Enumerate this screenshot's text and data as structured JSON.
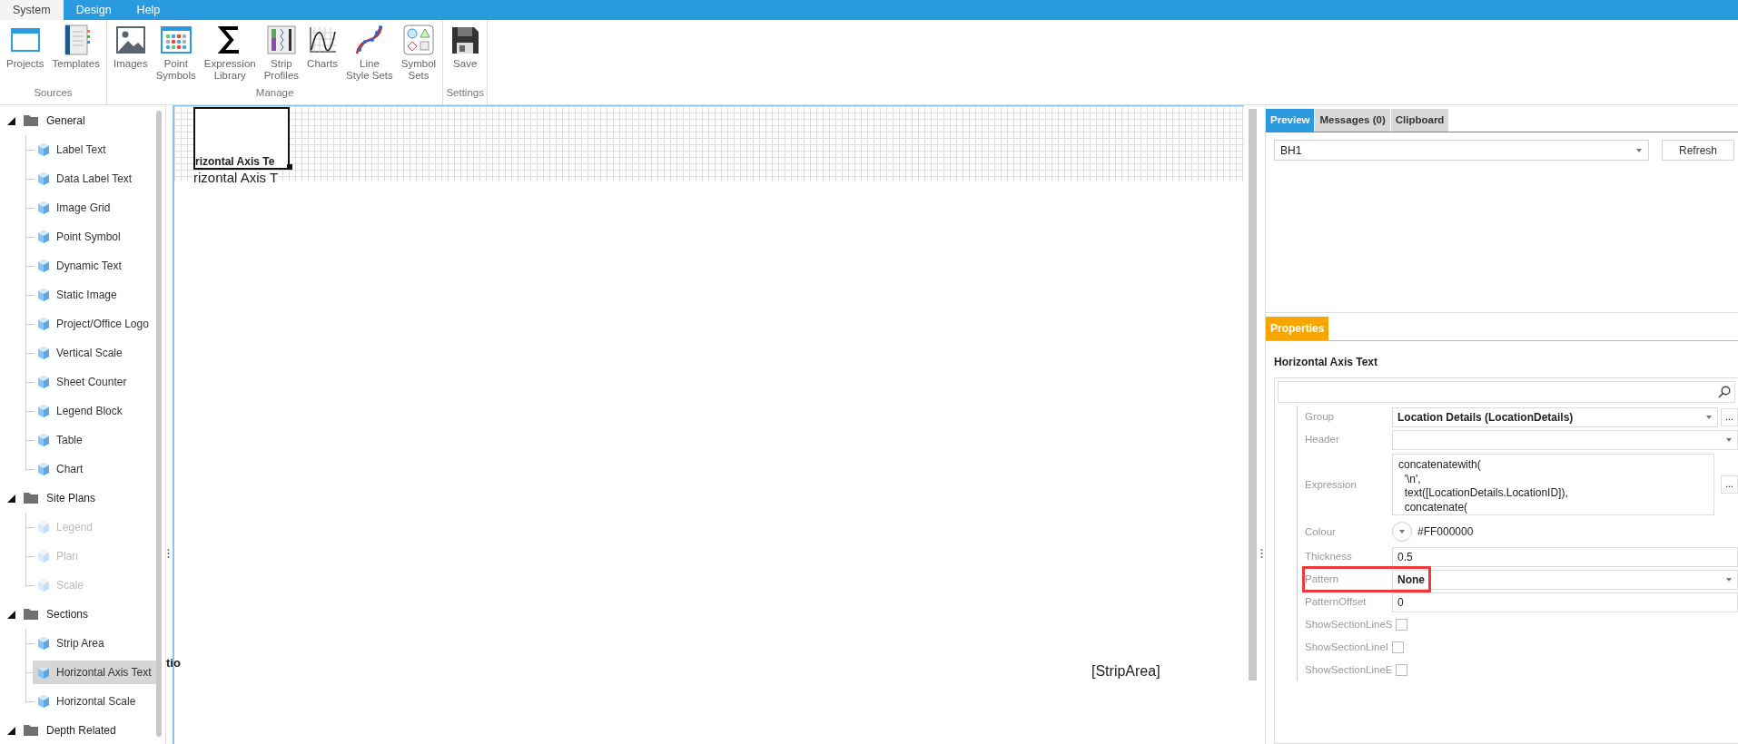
{
  "menu_tabs": [
    {
      "label": "System",
      "selected": true
    },
    {
      "label": "Design",
      "selected": false
    },
    {
      "label": "Help",
      "selected": false
    }
  ],
  "ribbon": {
    "groups": [
      {
        "label": "Sources",
        "buttons": [
          "Projects",
          "Templates"
        ]
      },
      {
        "label": "Manage",
        "buttons": [
          "Images",
          "Point\nSymbols",
          "Expression\nLibrary",
          "Strip\nProfiles",
          "Charts",
          "Line\nStyle Sets",
          "Symbol\nSets"
        ]
      },
      {
        "label": "Settings",
        "buttons": [
          "Save"
        ]
      }
    ]
  },
  "tree": [
    {
      "label": "General",
      "expanded": true,
      "children": [
        {
          "label": "Label Text",
          "disabled": false,
          "selected": false
        },
        {
          "label": "Data Label Text",
          "disabled": false,
          "selected": false
        },
        {
          "label": "Image Grid",
          "disabled": false,
          "selected": false
        },
        {
          "label": "Point Symbol",
          "disabled": false,
          "selected": false
        },
        {
          "label": "Dynamic Text",
          "disabled": false,
          "selected": false
        },
        {
          "label": "Static Image",
          "disabled": false,
          "selected": false
        },
        {
          "label": "Project/Office Logo",
          "disabled": false,
          "selected": false
        },
        {
          "label": "Vertical Scale",
          "disabled": false,
          "selected": false
        },
        {
          "label": "Sheet Counter",
          "disabled": false,
          "selected": false
        },
        {
          "label": "Legend Block",
          "disabled": false,
          "selected": false
        },
        {
          "label": "Table",
          "disabled": false,
          "selected": false
        },
        {
          "label": "Chart",
          "disabled": false,
          "selected": false
        }
      ]
    },
    {
      "label": "Site Plans",
      "expanded": true,
      "children": [
        {
          "label": "Legend",
          "disabled": true,
          "selected": false
        },
        {
          "label": "Plan",
          "disabled": true,
          "selected": false
        },
        {
          "label": "Scale",
          "disabled": true,
          "selected": false
        }
      ]
    },
    {
      "label": "Sections",
      "expanded": true,
      "children": [
        {
          "label": "Strip Area",
          "disabled": false,
          "selected": false
        },
        {
          "label": "Horizontal Axis Text",
          "disabled": false,
          "selected": true
        },
        {
          "label": "Horizontal Scale",
          "disabled": false,
          "selected": false
        }
      ]
    },
    {
      "label": "Depth Related",
      "expanded": true
    }
  ],
  "canvas": {
    "element_caption": "rizontal Axis Te",
    "element_text": "rizontal Axis T",
    "side_label": "tio",
    "strip_area_label": "[StripArea]"
  },
  "preview": {
    "tabs": [
      {
        "label": "Preview",
        "selected": true
      },
      {
        "label": "Messages (0)",
        "selected": false
      },
      {
        "label": "Clipboard",
        "selected": false
      }
    ],
    "borehole": "BH1",
    "refresh_button": "Refresh"
  },
  "properties": {
    "tab": "Properties",
    "title": "Horizontal Axis Text",
    "rows": [
      {
        "label": "Group",
        "kind": "dropdown",
        "value": "Location Details (LocationDetails)",
        "browse_button": "...",
        "highlighted": false
      },
      {
        "label": "Header",
        "kind": "dropdown",
        "highlighted": false
      },
      {
        "label": "Expression",
        "kind": "expression",
        "value": "concatenatewith(\n  '\\n',\n  text([LocationDetails.LocationID]),\n  concatenate(",
        "browse_button": "...",
        "highlighted": false
      },
      {
        "label": "Colour",
        "kind": "colour",
        "value": "#FF000000",
        "highlighted": false
      },
      {
        "label": "Thickness",
        "kind": "text",
        "value": "0.5",
        "highlighted": false
      },
      {
        "label": "Pattern",
        "kind": "dropdown",
        "value": "None",
        "highlighted": true
      },
      {
        "label": "PatternOffset",
        "kind": "text",
        "value": "0",
        "highlighted": false
      },
      {
        "label": "ShowSectionLineS",
        "kind": "checkbox",
        "checked": false,
        "highlighted": false
      },
      {
        "label": "ShowSectionLineI",
        "kind": "checkbox",
        "checked": false,
        "highlighted": false
      },
      {
        "label": "ShowSectionLineE",
        "kind": "checkbox",
        "checked": false,
        "highlighted": false
      }
    ]
  }
}
